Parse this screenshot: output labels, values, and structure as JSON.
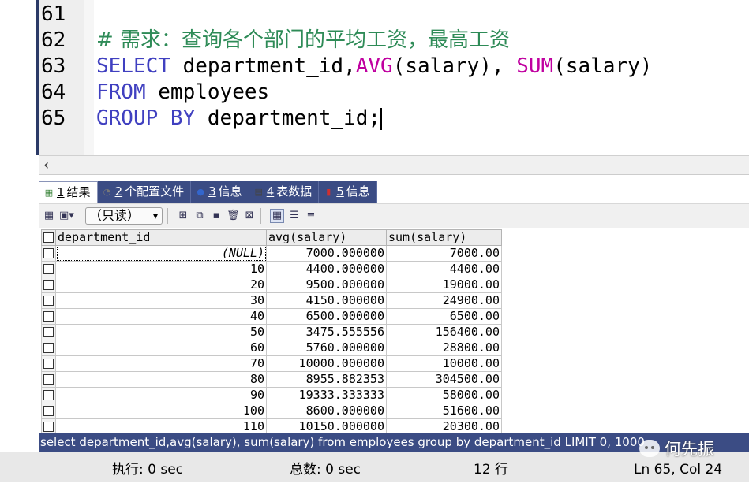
{
  "editor": {
    "lines": [
      {
        "no": "61",
        "parts": []
      },
      {
        "no": "62",
        "parts": [
          {
            "t": "# 需求：查询各个部门的平均工资，最高工资",
            "c": "comment"
          }
        ]
      },
      {
        "no": "63",
        "parts": [
          {
            "t": "SELECT",
            "c": "kw"
          },
          {
            "t": " department_id,",
            "c": "plain"
          },
          {
            "t": "AVG",
            "c": "fn"
          },
          {
            "t": "(salary), ",
            "c": "plain"
          },
          {
            "t": "SUM",
            "c": "fn"
          },
          {
            "t": "(salary)",
            "c": "plain"
          }
        ]
      },
      {
        "no": "64",
        "parts": [
          {
            "t": "FROM",
            "c": "kw"
          },
          {
            "t": " employees",
            "c": "plain"
          }
        ]
      },
      {
        "no": "65",
        "parts": [
          {
            "t": "GROUP BY",
            "c": "kw"
          },
          {
            "t": " department_id;",
            "c": "plain"
          }
        ],
        "cursor": true
      }
    ],
    "scroll_left_icon": "‹"
  },
  "tabs": [
    {
      "num": "1",
      "label": "结果",
      "icon": "grid-icon",
      "active": true
    },
    {
      "num": "2",
      "label": "个配置文件",
      "icon": "profile-icon",
      "active": false
    },
    {
      "num": "3",
      "label": "信息",
      "icon": "info-icon",
      "active": false
    },
    {
      "num": "4",
      "label": "表数据",
      "icon": "table-icon",
      "active": false
    },
    {
      "num": "5",
      "label": "信息",
      "icon": "chart-icon",
      "active": false
    }
  ],
  "toolbar": {
    "readonly_label": "（只读）"
  },
  "grid": {
    "columns": [
      "department_id",
      "avg(salary)",
      "sum(salary)"
    ],
    "rows": [
      [
        "(NULL)",
        "7000.000000",
        "7000.00"
      ],
      [
        "10",
        "4400.000000",
        "4400.00"
      ],
      [
        "20",
        "9500.000000",
        "19000.00"
      ],
      [
        "30",
        "4150.000000",
        "24900.00"
      ],
      [
        "40",
        "6500.000000",
        "6500.00"
      ],
      [
        "50",
        "3475.555556",
        "156400.00"
      ],
      [
        "60",
        "5760.000000",
        "28800.00"
      ],
      [
        "70",
        "10000.000000",
        "10000.00"
      ],
      [
        "80",
        "8955.882353",
        "304500.00"
      ],
      [
        "90",
        "19333.333333",
        "58000.00"
      ],
      [
        "100",
        "8600.000000",
        "51600.00"
      ],
      [
        "110",
        "10150.000000",
        "20300.00"
      ]
    ]
  },
  "sqlbar": {
    "text": "select department_id,avg(salary), sum(salary) from employees group by department_id LIMIT 0, 1000"
  },
  "status": {
    "exec": "执行: 0 sec",
    "total": "总数: 0 sec",
    "rows": "12 行",
    "position": "Ln 65, Col 24"
  },
  "watermark": {
    "text": "何先振"
  },
  "colors": {
    "keyword": "#4040c0",
    "function": "#c000a0",
    "comment": "#2e8b57",
    "accent_bar": "#3b4c84"
  }
}
